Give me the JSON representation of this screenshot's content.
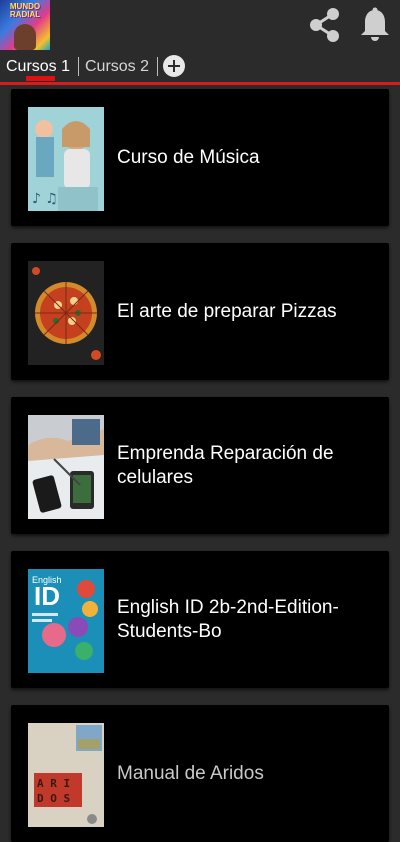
{
  "header": {
    "logo_text": "MUNDO RADIAL",
    "share_icon": "share-icon",
    "bell_icon": "bell-icon"
  },
  "tabs": [
    {
      "label": "Cursos 1",
      "active": true
    },
    {
      "label": "Cursos 2",
      "active": false
    }
  ],
  "add_tab_icon": "plus-circle-icon",
  "courses": [
    {
      "title": "Curso de Música",
      "thumb": "music-course-image"
    },
    {
      "title": "El arte de preparar Pizzas",
      "thumb": "pizza-image"
    },
    {
      "title": "Emprenda Reparación de celulares",
      "thumb": "phone-repair-image"
    },
    {
      "title": "English ID 2b-2nd-Edition-Students-Bo",
      "thumb": "english-id-book-cover"
    },
    {
      "title": "Manual de Aridos",
      "thumb": "aridos-book-cover"
    }
  ],
  "colors": {
    "background": "#2b2b2b",
    "card": "#000000",
    "accent": "#d81c1c"
  }
}
